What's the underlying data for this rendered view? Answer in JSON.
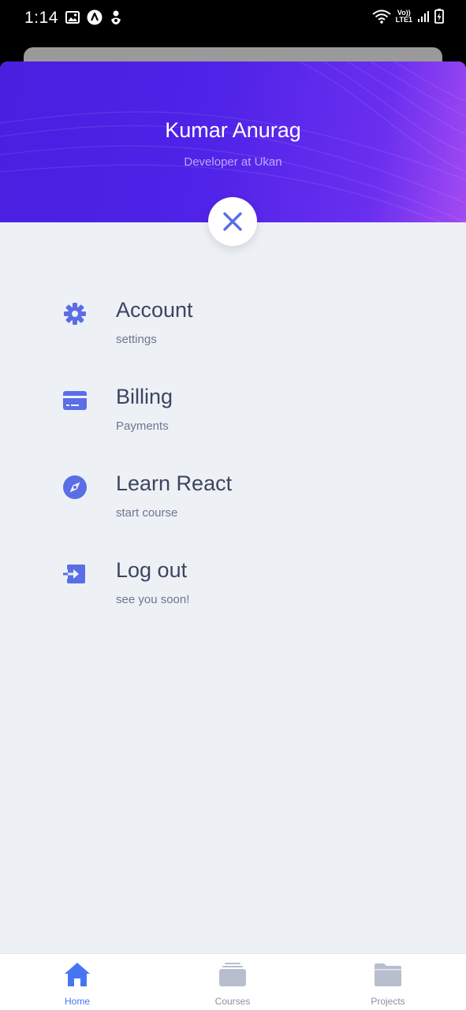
{
  "status_bar": {
    "time": "1:14",
    "network_top": "Vo))",
    "network_bottom": "LTE1"
  },
  "header": {
    "name": "Kumar Anurag",
    "role": "Developer at Ukan"
  },
  "menu": [
    {
      "title": "Account",
      "subtitle": "settings",
      "icon": "gear-icon"
    },
    {
      "title": "Billing",
      "subtitle": "Payments",
      "icon": "credit-card-icon"
    },
    {
      "title": "Learn React",
      "subtitle": "start course",
      "icon": "compass-icon"
    },
    {
      "title": "Log out",
      "subtitle": "see you soon!",
      "icon": "logout-icon"
    }
  ],
  "tabs": [
    {
      "label": "Home",
      "icon": "home-icon",
      "active": true
    },
    {
      "label": "Courses",
      "icon": "cards-icon",
      "active": false
    },
    {
      "label": "Projects",
      "icon": "folder-icon",
      "active": false
    }
  ],
  "colors": {
    "accent": "#5a6ee6",
    "header_start": "#4a1fe0",
    "header_end": "#a24af2",
    "sheet_bg": "#edf1f5",
    "active_tab": "#4775f2",
    "inactive_tab": "#b8bece"
  }
}
